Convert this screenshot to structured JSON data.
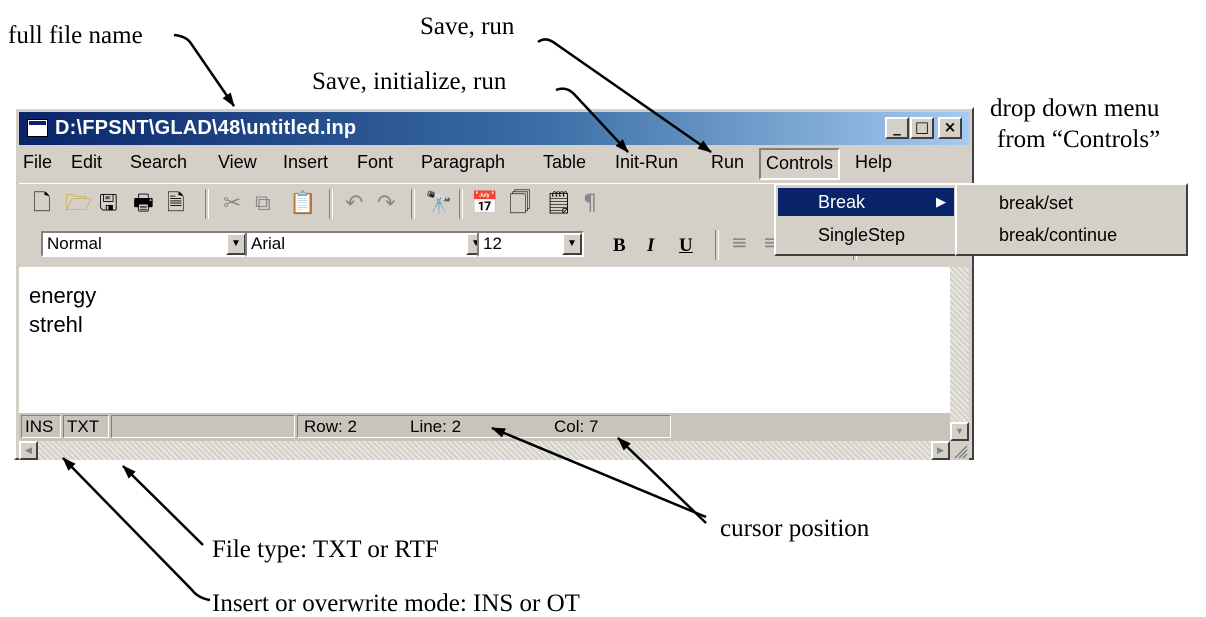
{
  "window": {
    "title": "D:\\FPSNT\\GLAD\\48\\untitled.inp",
    "caption_buttons": [
      "_",
      "□",
      "×"
    ]
  },
  "menubar": {
    "items": [
      "File",
      "Edit",
      "Search",
      "View",
      "Insert",
      "Font",
      "Paragraph",
      "Table",
      "Init-Run",
      "Run",
      "Controls",
      "Help"
    ],
    "active": "Controls"
  },
  "toolbar": {
    "icons": [
      "new-icon",
      "open-icon",
      "save-icon",
      "print-icon",
      "print-preview-icon",
      "cut-icon",
      "copy-icon",
      "paste-icon",
      "undo-icon",
      "redo-icon",
      "find-icon",
      "insert-date-icon",
      "page-icon",
      "page-number-icon",
      "pilcrow-icon"
    ]
  },
  "format_bar": {
    "style": "Normal",
    "font": "Arial",
    "size": "12",
    "bold": "B",
    "italic": "I",
    "underline": "U"
  },
  "document": {
    "lines": [
      "energy",
      "strehl"
    ]
  },
  "status": {
    "mode": "INS",
    "file_type": "TXT",
    "row": "Row: 2",
    "line": "Line: 2",
    "col": "Col: 7"
  },
  "controls_menu": {
    "items": [
      "Break",
      "SingleStep"
    ],
    "highlighted": "Break"
  },
  "break_submenu": {
    "items": [
      "break/set",
      "break/continue"
    ]
  },
  "annotations": {
    "full_file_name": "full file name",
    "save_run": "Save, run",
    "save_init_run": "Save, initialize, run",
    "drop_down_1": "drop down menu",
    "drop_down_2": "from “Controls”",
    "file_type": "File type: TXT or RTF",
    "cursor_position": "cursor position",
    "insert_mode": "Insert or overwrite mode: INS or OT"
  }
}
